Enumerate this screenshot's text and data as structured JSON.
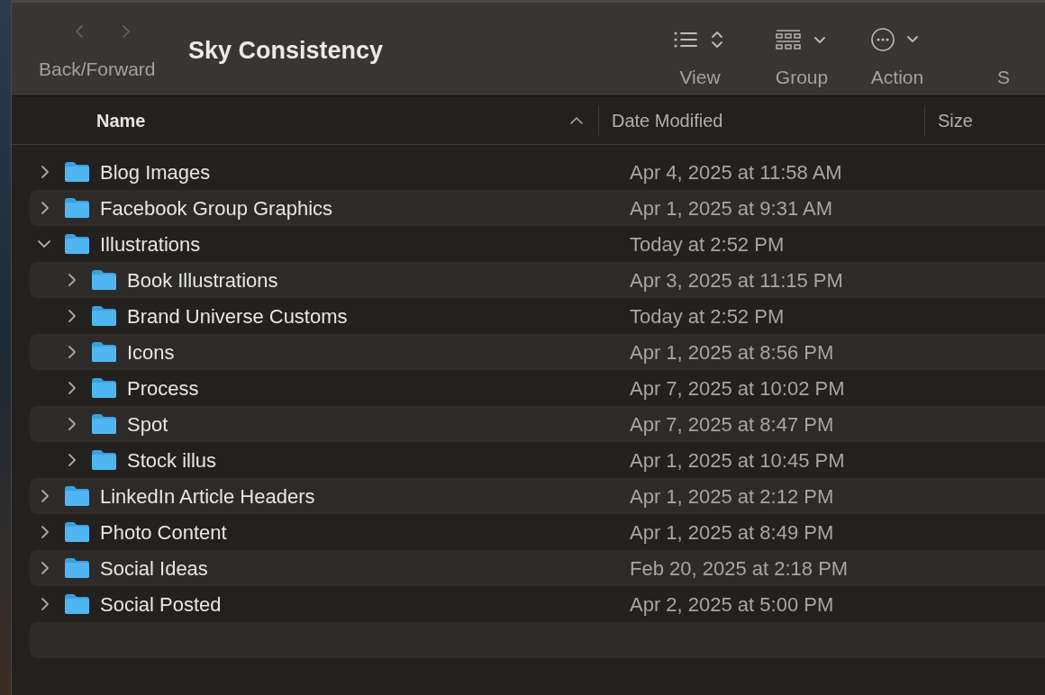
{
  "toolbar": {
    "nav": {
      "label": "Back/Forward",
      "back_disabled": true,
      "forward_disabled": true
    },
    "title": "Sky Consistency",
    "items": [
      {
        "kind": "view",
        "label": "View"
      },
      {
        "kind": "group",
        "label": "Group"
      },
      {
        "kind": "action",
        "label": "Action"
      },
      {
        "kind": "cut",
        "label": "S"
      }
    ]
  },
  "columns": [
    {
      "label": "Name",
      "sorted": true
    },
    {
      "label": "Date Modified",
      "sorted": false
    },
    {
      "label": "Size",
      "sorted": false
    }
  ],
  "rows": [
    {
      "name": "Blog Images",
      "date": "Apr 4, 2025 at 11:58 AM",
      "expanded": false
    },
    {
      "name": "Facebook Group Graphics",
      "date": "Apr 1, 2025 at 9:31 AM",
      "expanded": false
    },
    {
      "name": "Illustrations",
      "date": "Today at 2:52 PM",
      "expanded": true,
      "children": [
        {
          "name": "Book Illustrations",
          "date": "Apr 3, 2025 at 11:15 PM",
          "expanded": false
        },
        {
          "name": "Brand Universe Customs",
          "date": "Today at 2:52 PM",
          "expanded": false
        },
        {
          "name": "Icons",
          "date": "Apr 1, 2025 at 8:56 PM",
          "expanded": false
        },
        {
          "name": "Process",
          "date": "Apr 7, 2025 at 10:02 PM",
          "expanded": false
        },
        {
          "name": "Spot",
          "date": "Apr 7, 2025 at 8:47 PM",
          "expanded": false
        },
        {
          "name": "Stock illus",
          "date": "Apr 1, 2025 at 10:45 PM",
          "expanded": false
        }
      ]
    },
    {
      "name": "LinkedIn Article Headers",
      "date": "Apr 1, 2025 at 2:12 PM",
      "expanded": false
    },
    {
      "name": "Photo Content",
      "date": "Apr 1, 2025 at 8:49 PM",
      "expanded": false
    },
    {
      "name": "Social Ideas",
      "date": "Feb 20, 2025 at 2:18 PM",
      "expanded": false
    },
    {
      "name": "Social Posted",
      "date": "Apr 2, 2025 at 5:00 PM",
      "expanded": false
    }
  ]
}
